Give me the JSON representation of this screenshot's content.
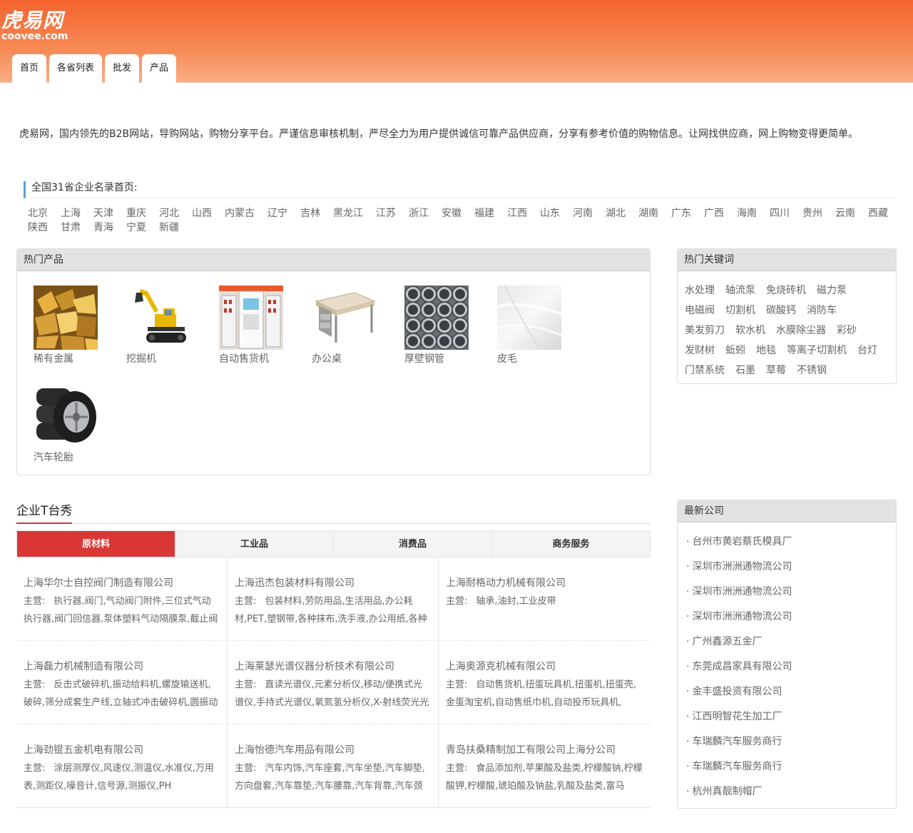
{
  "header": {
    "logo_cn": "虎易网",
    "logo_en": "coovee.com",
    "nav": [
      "首页",
      "各省列表",
      "批发",
      "产品"
    ]
  },
  "intro": "虎易网，国内领先的B2B网站，导购网站，购物分享平台。严谨信息审核机制，严尽全力为用户提供诚信可靠产品供应商，分享有参考价值的购物信息。让网找供应商，网上购物变得更简单。",
  "provinces": {
    "title": "全国31省企业名录首页:",
    "items": [
      "北京",
      "上海",
      "天津",
      "重庆",
      "河北",
      "山西",
      "内蒙古",
      "辽宁",
      "吉林",
      "黑龙江",
      "江苏",
      "浙江",
      "安徽",
      "福建",
      "江西",
      "山东",
      "河南",
      "湖北",
      "湖南",
      "广东",
      "广西",
      "海南",
      "四川",
      "贵州",
      "云南",
      "西藏",
      "陕西",
      "甘肃",
      "青海",
      "宁夏",
      "新疆"
    ]
  },
  "hot_products": {
    "title": "热门产品",
    "items": [
      {
        "name": "稀有金属",
        "icon": "rare-metal-image"
      },
      {
        "name": "挖掘机",
        "icon": "excavator-image"
      },
      {
        "name": "自动售货机",
        "icon": "vending-machine-image"
      },
      {
        "name": "办公桌",
        "icon": "office-desk-image"
      },
      {
        "name": "厚壁钢管",
        "icon": "steel-pipe-image"
      },
      {
        "name": "皮毛",
        "icon": "fur-image"
      },
      {
        "name": "汽车轮胎",
        "icon": "car-tire-image"
      }
    ]
  },
  "hot_keywords": {
    "title": "热门关键词",
    "items": [
      "水处理",
      "轴流泵",
      "免烧砖机",
      "磁力泵",
      "电磁阀",
      "切割机",
      "碳酸钙",
      "消防车",
      "美发剪刀",
      "软水机",
      "水膜除尘器",
      "彩砂",
      "发财树",
      "蚯蚓",
      "地毯",
      "等离子切割机",
      "台灯",
      "门禁系统",
      "石墨",
      "草莓",
      "不锈钢"
    ]
  },
  "showcase": {
    "title": "企业T台秀",
    "tabs": [
      "原材料",
      "工业品",
      "消费品",
      "商务服务"
    ],
    "main_label": "主营:",
    "companies": [
      {
        "name": "上海华尔士自控阀门制造有限公司",
        "main": "执行器,阀门,气动阀门附件,三位式气动执行器,阀门回信器,泵体塑料气动隔膜泵,截止阀"
      },
      {
        "name": "上海迅杰包装材料有限公司",
        "main": "包装材料,劳防用品,生活用品,办公耗材,PET,塑钢带,各种抹布,洗手液,办公用纸,各种"
      },
      {
        "name": "上海耐格动力机械有限公司",
        "main": "轴承,油封,工业皮带"
      },
      {
        "name": "上海磊力机械制造有限公司",
        "main": "反击式破碎机,振动给料机,螺旋输送机,破碎,筛分成套生产线,立轴式冲击破碎机,圆振动"
      },
      {
        "name": "上海莱瑟光谱仪器分析技术有限公司",
        "main": "直读光谱仪,元素分析仪,移动/便携式光谱仪,手持式光谱仪,氧氮氢分析仪,X-射线荧光光"
      },
      {
        "name": "上海奥源克机械有限公司",
        "main": "自动售货机,扭蛋玩具机,扭蛋机,扭蛋壳,金蛋淘宝机,自动售纸巾机,自动投币玩具机,"
      },
      {
        "name": "上海劲锟五金机电有限公司",
        "main": "涂层测厚仪,风速仪,测温仪,水准仪,万用表,测距仪,噪音计,信号源,测振仪,PH"
      },
      {
        "name": "上海怡德汽车用品有限公司",
        "main": "汽车内饰,汽车座套,汽车坐垫,汽车脚垫,方向盘套,汽车靠垫,汽车腰靠,汽车背靠,汽车颈"
      },
      {
        "name": "青岛扶桑精制加工有限公司上海分公司",
        "main": "食品添加剂,苹果酸及盐类,柠檬酸钠,柠檬酸钾,柠檬酸,琥珀酸及钠盐,乳酸及盐类,富马"
      }
    ]
  },
  "latest_companies": {
    "title": "最新公司",
    "items": [
      "台州市黄岩蔡氏模具厂",
      "深圳市洲洲通物流公司",
      "深圳市洲洲通物流公司",
      "深圳市洲洲通物流公司",
      "广州鑫源五金厂",
      "东莞成昌家具有限公司",
      "金丰盛投资有限公司",
      "江西明智花生加工厂",
      "车瑞麟汽车服务商行",
      "车瑞麟汽车服务商行",
      "杭州真靓制帽厂"
    ]
  },
  "colors": {
    "header_top": "#f4622d",
    "accent_red": "#d93636",
    "province_marker": "#5a9fd4"
  }
}
